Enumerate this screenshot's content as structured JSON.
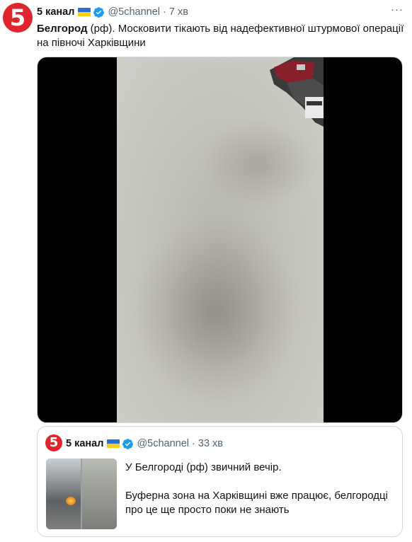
{
  "tweet": {
    "avatar_text": "5",
    "display_name": "5 канал",
    "handle": "@5channel",
    "separator": "·",
    "time": "7 хв",
    "more_label": "···",
    "text_bold": "Белгород",
    "text_rest": " (рф). Московити тікають від надефективної штурмової операції на півночі Харківщини"
  },
  "quoted": {
    "avatar_text": "5",
    "display_name": "5 канал",
    "handle": "@5channel",
    "separator": "·",
    "time": "33 хв",
    "line1": "У Белгороді (рф) звичний вечір.",
    "line2": "Буферна зона на Харківщині вже працює, белгородці про це ще просто поки не знають"
  },
  "colors": {
    "brand_red": "#e0262c",
    "verified_blue": "#1d9bf0",
    "flag_blue": "#2b6fd6",
    "flag_yellow": "#f7d117"
  },
  "icons": {
    "verified": "verified-badge-icon",
    "flag": "ukraine-flag-icon",
    "more": "more-options-icon"
  }
}
